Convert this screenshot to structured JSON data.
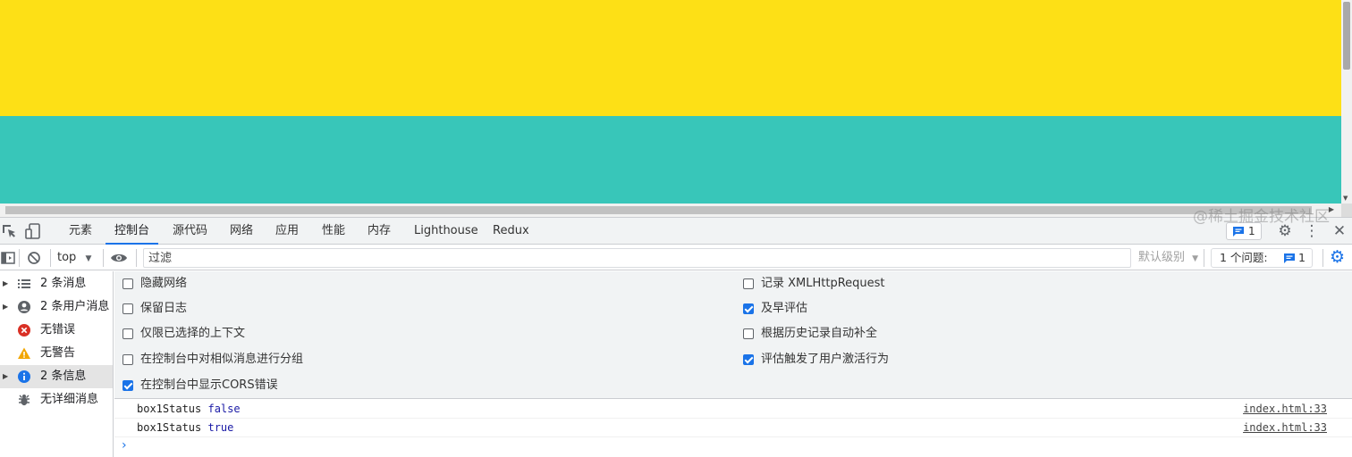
{
  "devtools": {
    "tabs": [
      "元素",
      "控制台",
      "源代码",
      "网络",
      "应用",
      "性能",
      "内存",
      "Lighthouse",
      "Redux"
    ],
    "active_tab": "控制台",
    "issues_badge_count": "1"
  },
  "toolbar": {
    "context": "top",
    "filter_placeholder": "过滤",
    "level": "默认级别",
    "issues_label": "1 个问题:",
    "issues_count": "1"
  },
  "sidebar": {
    "items": [
      {
        "label": "2 条消息",
        "icon": "list-icon",
        "color": "#5f6368"
      },
      {
        "label": "2 条用户消息",
        "icon": "user-icon",
        "color": "#5f6368"
      },
      {
        "label": "无错误",
        "icon": "error-icon",
        "color": "#d93025"
      },
      {
        "label": "无警告",
        "icon": "warning-icon",
        "color": "#f2a600"
      },
      {
        "label": "2 条信息",
        "icon": "info-icon",
        "color": "#1a73e8"
      },
      {
        "label": "无详细消息",
        "icon": "bug-icon",
        "color": "#5f6368"
      }
    ]
  },
  "settings": {
    "left": [
      {
        "label": "隐藏网络",
        "checked": false
      },
      {
        "label": "保留日志",
        "checked": false
      },
      {
        "label": "仅限已选择的上下文",
        "checked": false
      },
      {
        "label": "在控制台中对相似消息进行分组",
        "checked": false
      },
      {
        "label": "在控制台中显示CORS错误",
        "checked": true
      }
    ],
    "right": [
      {
        "label": "记录 XMLHttpRequest",
        "checked": false
      },
      {
        "label": "及早评估",
        "checked": true
      },
      {
        "label": "根据历史记录自动补全",
        "checked": false
      },
      {
        "label": "评估触发了用户激活行为",
        "checked": true
      }
    ]
  },
  "messages": [
    {
      "text": "box1Status",
      "value": "false",
      "source": "index.html:33"
    },
    {
      "text": "box1Status",
      "value": "true",
      "source": "index.html:33"
    }
  ],
  "watermark": "@稀土掘金技术社区",
  "colors": {
    "yellow_box": "#fde016",
    "teal_box": "#38c6b9",
    "accent": "#1a73e8"
  }
}
